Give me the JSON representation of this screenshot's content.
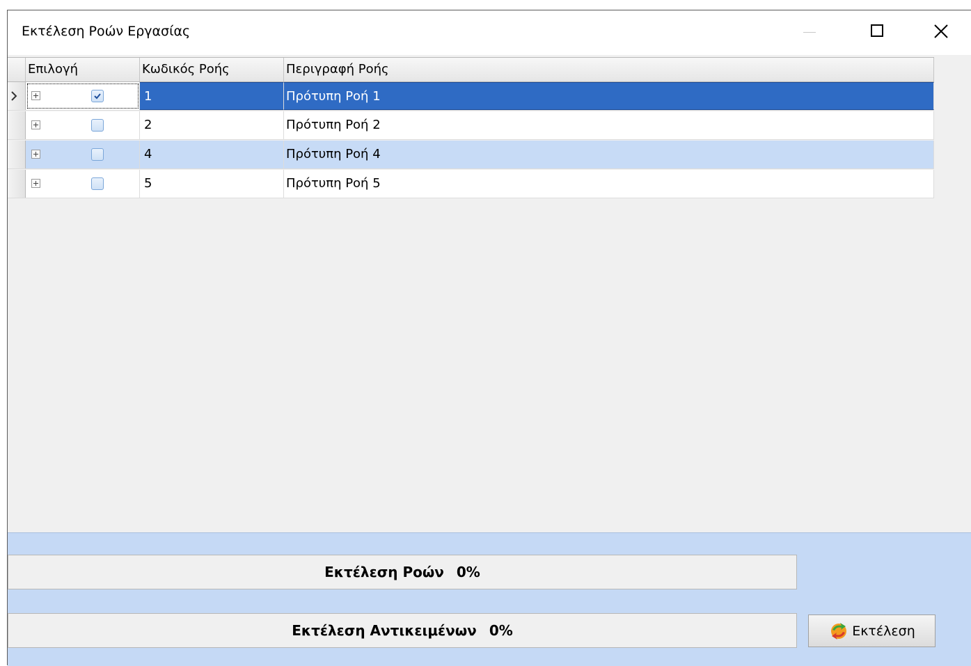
{
  "window": {
    "title": "Εκτέλεση Ροών Εργασίας"
  },
  "grid": {
    "columns": [
      "Επιλογή",
      "Κωδικός Ροής",
      "Περιγραφή Ροής"
    ],
    "rows": [
      {
        "code": "1",
        "description": "Πρότυπη Ροή 1",
        "checked": true,
        "state": "selected"
      },
      {
        "code": "2",
        "description": "Πρότυπη Ροή 2",
        "checked": false,
        "state": "normal"
      },
      {
        "code": "4",
        "description": "Πρότυπη Ροή 4",
        "checked": false,
        "state": "alternate"
      },
      {
        "code": "5",
        "description": "Πρότυπη Ροή 5",
        "checked": false,
        "state": "normal"
      }
    ]
  },
  "progress": {
    "flows": {
      "label": "Εκτέλεση Ροών",
      "value": "0%"
    },
    "objects": {
      "label": "Εκτέλεση Αντικειμένων",
      "value": "0%"
    }
  },
  "actions": {
    "run_label": "Εκτέλεση"
  },
  "colors": {
    "selected_row": "#2f6bc4",
    "alternate_row": "#c7dbf6",
    "panel": "#c5d9f5"
  },
  "icons": [
    "minimize-icon",
    "maximize-icon",
    "close-icon",
    "expand-plus-icon",
    "checkbox-icon",
    "row-indicator-arrow-icon",
    "run-icon"
  ]
}
